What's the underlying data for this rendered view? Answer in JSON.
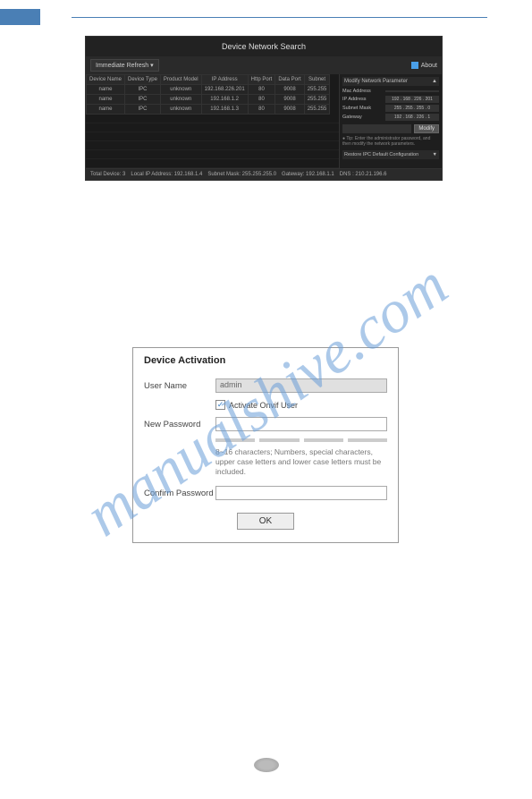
{
  "watermark": "manualshive.com",
  "dns": {
    "title": "Device Network Search",
    "refresh": "Immediate Refresh ▾",
    "about": "About",
    "headers": [
      "Device Name",
      "Device Type",
      "Product Model",
      "IP Address",
      "Http Port",
      "Data Port",
      "Subnet"
    ],
    "rows": [
      {
        "name": "name",
        "type": "IPC",
        "model": "unknown",
        "ip": "192.168.226.201",
        "http": "80",
        "data": "9008",
        "subnet": "255.255"
      },
      {
        "name": "name",
        "type": "IPC",
        "model": "unknown",
        "ip": "192.168.1.2",
        "http": "80",
        "data": "9008",
        "subnet": "255.255"
      },
      {
        "name": "name",
        "type": "IPC",
        "model": "unknown",
        "ip": "192.168.1.3",
        "http": "80",
        "data": "9008",
        "subnet": "255.255"
      }
    ],
    "side": {
      "title": "Modify Network Parameter",
      "mac_label": "Mac Address",
      "mac": "",
      "ip_label": "IP Address",
      "ip": "192 . 168 . 226 . 201",
      "mask_label": "Subnet Mask",
      "mask": "255 . 255 . 255 . 0",
      "gw_label": "Gateway",
      "gw": "192 . 168 . 226 . 1",
      "modify": "Modify",
      "tip": "● Tip: Enter the administrator password, and then modify the network parameters.",
      "restore": "Restore IPC Default Configuration"
    },
    "footer": {
      "total": "Total Device: 3",
      "local": "Local IP Address: 192.168.1.4",
      "mask": "Subnet Mask: 255.255.255.0",
      "gw": "Gateway: 192.168.1.1",
      "dns": "DNS : 210.21.196.6"
    }
  },
  "activation": {
    "title": "Device Activation",
    "user_label": "User Name",
    "user_value": "admin",
    "onvif": "Activate Onvif User",
    "newpw_label": "New Password",
    "hint": "8~16 characters; Numbers, special characters, upper case letters and lower case letters must be included.",
    "confirm_label": "Confirm Password",
    "ok": "OK"
  }
}
